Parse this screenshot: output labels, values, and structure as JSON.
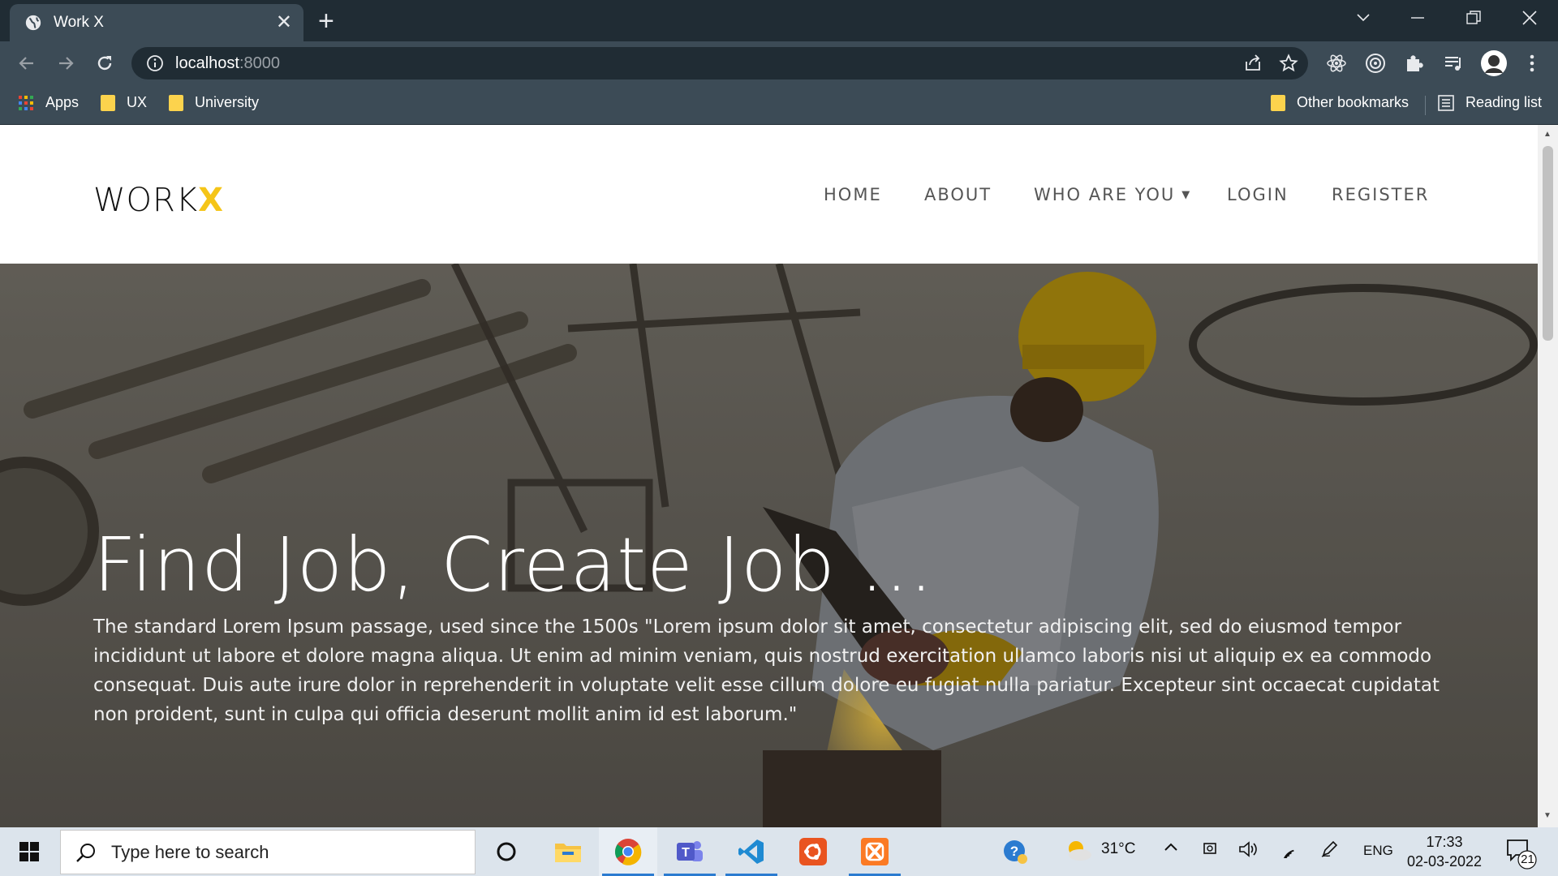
{
  "browser": {
    "tab_title": "Work X",
    "tab_close": "✕",
    "new_tab": "+",
    "url_host": "localhost",
    "url_port": ":8000",
    "bookmarks": {
      "apps": "Apps",
      "ux": "UX",
      "university": "University",
      "other": "Other bookmarks",
      "reading_list": "Reading list"
    }
  },
  "site": {
    "logo_main": "WORK",
    "logo_accent": "X",
    "nav": {
      "home": "HOME",
      "about": "ABOUT",
      "who": "WHO ARE YOU",
      "login": "LOGIN",
      "register": "REGISTER"
    },
    "hero_title": "Find Job, Create Job ...",
    "hero_text": "The standard Lorem Ipsum passage, used since the 1500s \"Lorem ipsum dolor sit amet, consectetur adipiscing elit, sed do eiusmod tempor incididunt ut labore et dolore magna aliqua. Ut enim ad minim veniam, quis nostrud exercitation ullamco laboris nisi ut aliquip ex ea commodo consequat. Duis aute irure dolor in reprehenderit in voluptate velit esse cillum dolore eu fugiat nulla pariatur. Excepteur sint occaecat cupidatat non proident, sunt in culpa qui officia deserunt mollit anim id est laborum.\"",
    "accent_color": "#f5c518"
  },
  "taskbar": {
    "search_placeholder": "Type here to search",
    "weather": "31°C",
    "language": "ENG",
    "time": "17:33",
    "date": "02-03-2022",
    "notifications": "21"
  }
}
